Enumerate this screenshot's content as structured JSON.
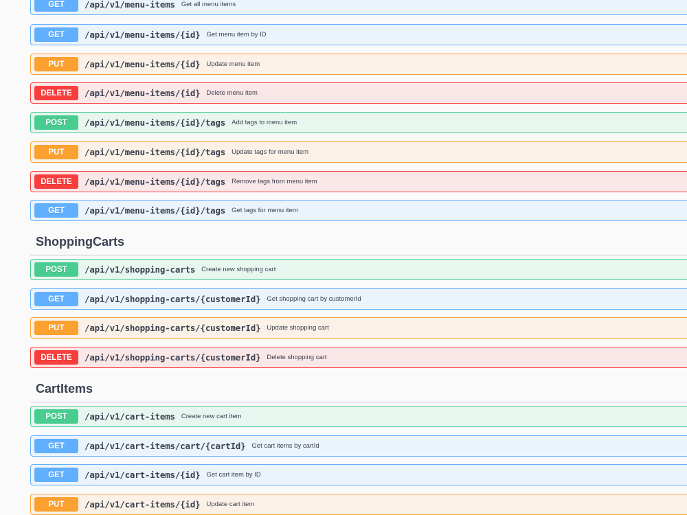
{
  "colors": {
    "get": "#61affe",
    "put": "#fca130",
    "post": "#49cc90",
    "delete": "#f93e3e"
  },
  "sections": [
    {
      "title": "",
      "ops": [
        {
          "method": "GET",
          "path": "/api/v1/menu-items",
          "summary": "Get all menu items"
        },
        {
          "method": "GET",
          "path": "/api/v1/menu-items/{id}",
          "summary": "Get menu item by ID"
        },
        {
          "method": "PUT",
          "path": "/api/v1/menu-items/{id}",
          "summary": "Update menu item"
        },
        {
          "method": "DELETE",
          "path": "/api/v1/menu-items/{id}",
          "summary": "Delete menu item"
        },
        {
          "method": "POST",
          "path": "/api/v1/menu-items/{id}/tags",
          "summary": "Add tags to menu item"
        },
        {
          "method": "PUT",
          "path": "/api/v1/menu-items/{id}/tags",
          "summary": "Update tags for menu item"
        },
        {
          "method": "DELETE",
          "path": "/api/v1/menu-items/{id}/tags",
          "summary": "Remove tags from menu item"
        },
        {
          "method": "GET",
          "path": "/api/v1/menu-items/{id}/tags",
          "summary": "Get tags for menu item"
        }
      ]
    },
    {
      "title": "ShoppingCarts",
      "ops": [
        {
          "method": "POST",
          "path": "/api/v1/shopping-carts",
          "summary": "Create new shopping cart"
        },
        {
          "method": "GET",
          "path": "/api/v1/shopping-carts/{customerId}",
          "summary": "Get shopping cart by customerId"
        },
        {
          "method": "PUT",
          "path": "/api/v1/shopping-carts/{customerId}",
          "summary": "Update shopping cart"
        },
        {
          "method": "DELETE",
          "path": "/api/v1/shopping-carts/{customerId}",
          "summary": "Delete shopping cart"
        }
      ]
    },
    {
      "title": "CartItems",
      "ops": [
        {
          "method": "POST",
          "path": "/api/v1/cart-items",
          "summary": "Create new cart item"
        },
        {
          "method": "GET",
          "path": "/api/v1/cart-items/cart/{cartId}",
          "summary": "Get cart items by cartId"
        },
        {
          "method": "GET",
          "path": "/api/v1/cart-items/{id}",
          "summary": "Get cart item by ID"
        },
        {
          "method": "PUT",
          "path": "/api/v1/cart-items/{id}",
          "summary": "Update cart item"
        }
      ]
    }
  ]
}
